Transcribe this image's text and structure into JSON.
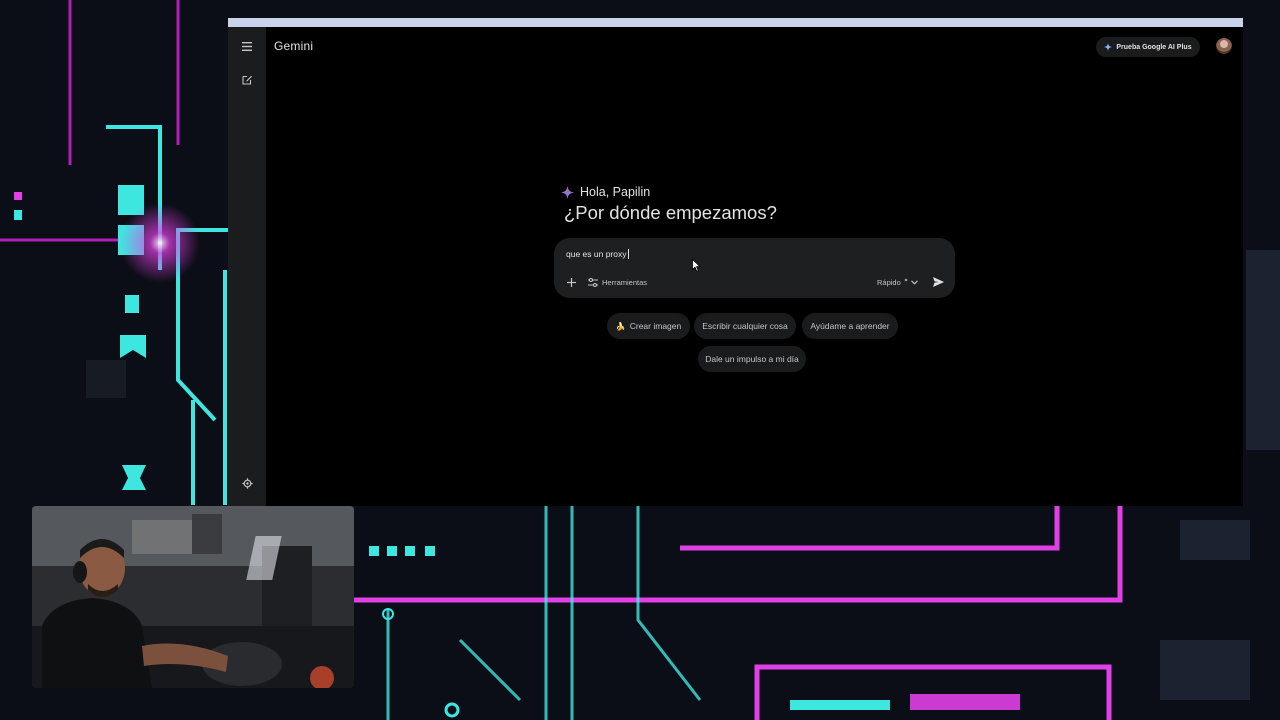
{
  "app": {
    "title": "Gemini",
    "upgrade_label": "Prueba Google AI Plus"
  },
  "sidebar": {
    "menu_icon": "menu-icon",
    "new_chat_icon": "edit-icon",
    "settings_icon": "settings-icon"
  },
  "greeting": {
    "text": "Hola, Papilin",
    "headline": "¿Por dónde empezamos?"
  },
  "prompt": {
    "value": "que es un proxy",
    "tools_label": "Herramientas",
    "model_label": "Rápido",
    "add_icon": "plus-icon",
    "send_icon": "send-icon"
  },
  "suggestions": {
    "create_image": "Crear imagen",
    "create_image_icon": "banana-emoji",
    "write": "Escribir cualquier cosa",
    "learn": "Ayúdame a aprender",
    "boost": "Dale un impulso a mi día"
  },
  "colors": {
    "page_bg": "#000000",
    "rail_bg": "#1b1c1e",
    "input_bg": "#1e1f20",
    "chip_bg": "#1a1b1d",
    "text": "#e3e3e3",
    "muted_text": "#c4c7c5",
    "neon_cyan": "#3ee6e0",
    "neon_magenta": "#e040e6"
  }
}
